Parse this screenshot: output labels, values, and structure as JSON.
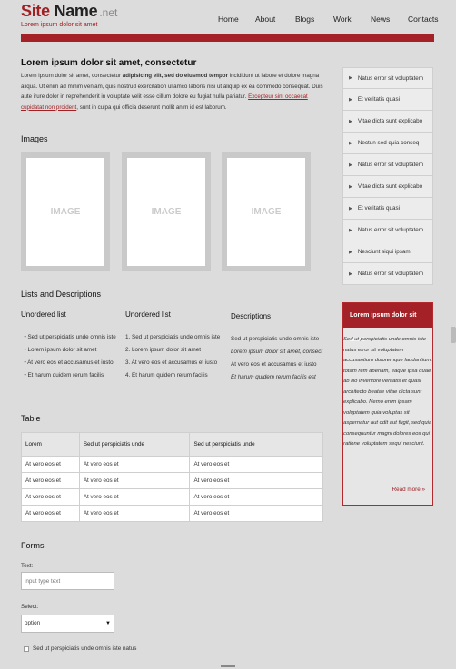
{
  "header": {
    "logo_site": "Site",
    "logo_name": "Name",
    "logo_tld": ".net",
    "tagline": "Lorem ipsum dolor sit amet"
  },
  "nav": [
    "Home",
    "About",
    "Blogs",
    "Work",
    "News",
    "Contacts"
  ],
  "intro": {
    "title": "Lorem ipsum dolor sit amet, consectetur",
    "text_before": "Lorem ipsum dolor sit amet, consectetur ",
    "bold": "adipisicing elit, sed do eiusmod tempor",
    "text_mid": " incididunt ut labore et dolore magna aliqua. Ut enim ad minim veniam, quis nostrud exercitation ullamco laboris nisi ut aliquip ex ea commodo consequat. Duis aute irure dolor in reprehenderit in voluptate velit esse cillum dolore eu fugiat nulla pariatur. ",
    "link": "Excepteur sint occaecat cupidatat non proident",
    "text_after": ", sunt in culpa qui officia deserunt mollit anim id est laborum."
  },
  "images": {
    "title": "Images",
    "placeholders": [
      "IMAGE",
      "IMAGE",
      "IMAGE"
    ]
  },
  "lists": {
    "title": "Lists and Descriptions",
    "unordered": {
      "title": "Unordered list",
      "items": [
        "Sed ut perspiciatis unde omnis iste",
        "Lorem ipsum dolor sit amet",
        "At vero eos et accusamus et iusto",
        "Et harum quidem rerum facilis"
      ]
    },
    "ordered": {
      "title": "Unordered list",
      "items": [
        "1. Sed ut perspiciatis unde omnis iste",
        "2. Lorem ipsum dolor sit amet",
        "3. At vero eos et accusamus et iusto",
        "4. Et harum quidem rerum facilis"
      ]
    },
    "descriptions": {
      "title": "Descriptions",
      "items": [
        "Sed ut perspiciatis unde omnis iste",
        "Lorem ipsum dolor sit amet, consect",
        "At vero eos et accusamus et iusto",
        "Et harum quidem rerum facilis est"
      ]
    }
  },
  "table": {
    "title": "Table",
    "headers": [
      "Lorem",
      "Sed ut perspiciatis unde",
      "Sed ut perspiciatis unde"
    ],
    "rows": [
      [
        "At vero eos et",
        "At vero eos et",
        "At vero eos et"
      ],
      [
        "At vero eos et",
        "At vero eos et",
        "At vero eos et"
      ],
      [
        "At vero eos et",
        "At vero eos et",
        "At vero eos et"
      ],
      [
        "At vero eos et",
        "At vero eos et",
        "At vero eos et"
      ]
    ]
  },
  "forms": {
    "title": "Forms",
    "text_label": "Text:",
    "text_placeholder": "input type text",
    "select_label": "Select:",
    "select_value": "option",
    "checkbox_label": "Sed ut perspiciatis unde omnis iste natus"
  },
  "sidebar": {
    "menu": [
      "Natus error sit voluptatem",
      "Et veritatis quasi",
      "Vitae dicta sunt explicabo",
      "Nectun sed quia conseq",
      "Natus error sit voluptatem",
      "Vitae dicta sunt explicabo",
      "Et veritatis quasi",
      "Natus error sit voluptatem",
      "Nesciunt siqui ipsam",
      "Natus error sit voluptatem"
    ],
    "box_title": "Lorem ipsum dolor sit amet",
    "box_text": "Sed ut perspiciatis unde omnis iste natus error sit voluptatem accusantium doloremque laudantium, totam rem aperiam, eaque ipsa quae ab illo inventore veritatis et quasi architecto beatae vitae dicta sunt explicabo. Nemo enim ipsam voluptatem quia voluptas sit aspernatur aut odit aut fugit, sed quia consequuntur magni dolores eos qui ratione voluptatem sequi nesciunt.",
    "read_more": "Read more »"
  },
  "colors": {
    "brand_red": "#a32127",
    "background": "#dcdcdc"
  }
}
